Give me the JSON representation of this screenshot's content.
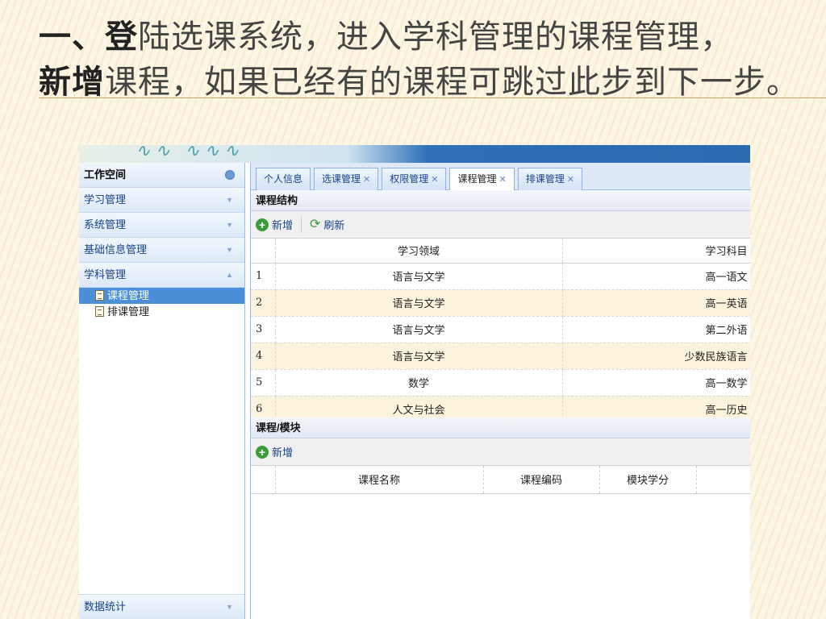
{
  "slide": {
    "title_bold_1": "一、登",
    "title_rest_1": "陆选课系统，进入学科管理的课程管理，",
    "title_bold_2": "新增",
    "title_rest_2": "课程，如果已经有的课程可跳过此步到下一步。"
  },
  "sidebar": {
    "workspace": "工作空间",
    "sections": [
      {
        "label": "学习管理"
      },
      {
        "label": "系统管理"
      },
      {
        "label": "基础信息管理"
      },
      {
        "label": "学科管理"
      }
    ],
    "items": [
      {
        "label": "课程管理",
        "selected": true
      },
      {
        "label": "排课管理",
        "selected": false
      }
    ],
    "bottom_section": "数据统计"
  },
  "tabs": [
    {
      "label": "个人信息",
      "closable": false
    },
    {
      "label": "选课管理",
      "closable": true
    },
    {
      "label": "权限管理",
      "closable": true
    },
    {
      "label": "课程管理",
      "closable": true,
      "active": true
    },
    {
      "label": "排课管理",
      "closable": true
    }
  ],
  "structure_panel": {
    "title": "课程结构",
    "add_label": "新增",
    "refresh_label": "刷新",
    "columns": [
      "学习领域",
      "学习科目"
    ],
    "rows": [
      {
        "num": "1",
        "domain": "语言与文学",
        "subject": "高一语文"
      },
      {
        "num": "2",
        "domain": "语言与文学",
        "subject": "高一英语"
      },
      {
        "num": "3",
        "domain": "语言与文学",
        "subject": "第二外语"
      },
      {
        "num": "4",
        "domain": "语言与文学",
        "subject": "少数民族语言"
      },
      {
        "num": "5",
        "domain": "数学",
        "subject": "高一数学"
      },
      {
        "num": "6",
        "domain": "人文与社会",
        "subject": "高一历史"
      }
    ]
  },
  "module_panel": {
    "title": "课程/模块",
    "add_label": "新增",
    "columns": [
      "课程名称",
      "课程编码",
      "模块学分"
    ]
  },
  "colors": {
    "accent_blue": "#2b6cb3",
    "row_alt": "#fbf3dc",
    "add_green": "#3d9b3a"
  }
}
